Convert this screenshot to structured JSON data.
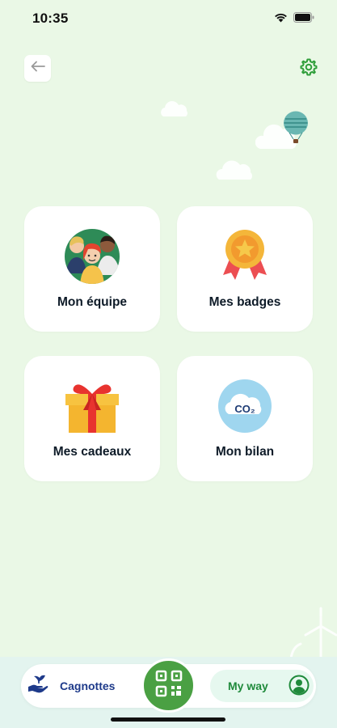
{
  "status": {
    "time": "10:35"
  },
  "menu": {
    "team": "Mon équipe",
    "badges": "Mes badges",
    "gifts": "Mes cadeaux",
    "bilan": "Mon bilan",
    "co2": "CO₂"
  },
  "nav": {
    "cagnottes": "Cagnottes",
    "my_way": "My way"
  },
  "colors": {
    "background": "#eaf8e6",
    "accent_green": "#4aa043",
    "nav_text_blue": "#1e3a8a",
    "my_way_green": "#1f8a3b"
  }
}
